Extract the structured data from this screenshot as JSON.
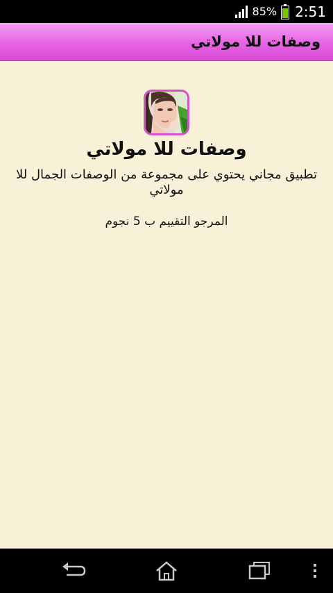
{
  "status_bar": {
    "battery_percent": "85%",
    "time": "2:51",
    "icons": [
      "signal-icon",
      "battery-icon"
    ]
  },
  "action_bar": {
    "title": "وصفات للا مولاتي"
  },
  "content": {
    "app_icon": "app-icon-woman-face",
    "heading": "وصفات للا مولاتي",
    "description": "تطبيق مجاني يحتوي على مجموعة من الوصفات الجمال للا مولاتي",
    "rating_note": "المرجو التقييم ب 5 نجوم"
  },
  "nav_bar": {
    "icons": [
      "back-icon",
      "home-icon",
      "recents-icon",
      "overflow-menu-icon"
    ]
  },
  "colors": {
    "action_bar": "#e663e3",
    "background": "#f8f1d8",
    "battery": "#7bc600"
  }
}
